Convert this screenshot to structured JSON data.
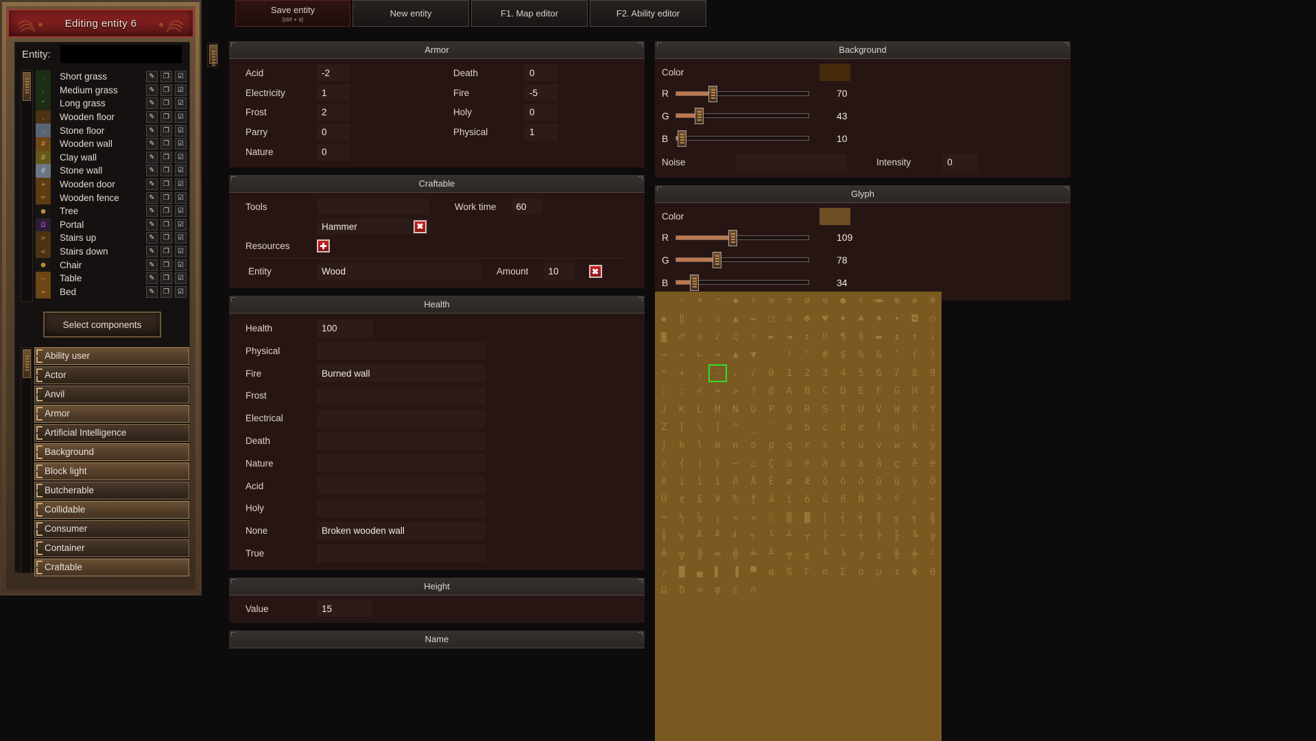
{
  "window": {
    "title": "Editing entity 6"
  },
  "left": {
    "entity_label": "Entity:",
    "entity_value": "",
    "select_components_label": "Select components",
    "entities": [
      {
        "name": "Short grass",
        "glyph": ".",
        "glyph_color": "#4e7a3a",
        "bg": "#1d2d16"
      },
      {
        "name": "Medium grass",
        "glyph": ",",
        "glyph_color": "#4e7a3a",
        "bg": "#1d2d16"
      },
      {
        "name": "Long grass",
        "glyph": "“",
        "glyph_color": "#4e7a3a",
        "bg": "#1d2d16"
      },
      {
        "name": "Wooden floor",
        "glyph": ".",
        "glyph_color": "#b07a38",
        "bg": "#4a3213"
      },
      {
        "name": "Stone floor",
        "glyph": ".",
        "glyph_color": "#9aa7b5",
        "bg": "#5a6472"
      },
      {
        "name": "Wooden wall",
        "glyph": "#",
        "glyph_color": "#c88a45",
        "bg": "#6d4616"
      },
      {
        "name": "Clay wall",
        "glyph": "#",
        "glyph_color": "#b2a13c",
        "bg": "#63591c"
      },
      {
        "name": "Stone wall",
        "glyph": "#",
        "glyph_color": "#b4bcc6",
        "bg": "#6b7684"
      },
      {
        "name": "Wooden door",
        "glyph": "+",
        "glyph_color": "#c88a45",
        "bg": "#5c3c13"
      },
      {
        "name": "Wooden fence",
        "glyph": "=",
        "glyph_color": "#c88a45",
        "bg": "#5c3c13"
      },
      {
        "name": "Tree",
        "glyph": "●",
        "glyph_color": "#c08b3c",
        "bg": "#181513"
      },
      {
        "name": "Portal",
        "glyph": "Ω",
        "glyph_color": "#d24fd2",
        "bg": "#2a1f36"
      },
      {
        "name": "Stairs up",
        "glyph": ">",
        "glyph_color": "#c88a45",
        "bg": "#4a3213"
      },
      {
        "name": "Stairs down",
        "glyph": "<",
        "glyph_color": "#c88a45",
        "bg": "#4a3213"
      },
      {
        "name": "Chair",
        "glyph": "●",
        "glyph_color": "#c08b3c",
        "bg": "#181513"
      },
      {
        "name": "Table",
        "glyph": "—",
        "glyph_color": "#c08b3c",
        "bg": "#6d4616"
      },
      {
        "name": "Bed",
        "glyph": "=",
        "glyph_color": "#d2894a",
        "bg": "#6d4616"
      }
    ],
    "row_buttons": [
      "picker-icon",
      "copy-icon",
      "edit-icon"
    ],
    "components": [
      {
        "label": "Ability user",
        "active": true
      },
      {
        "label": "Actor",
        "active": false
      },
      {
        "label": "Anvil",
        "active": false
      },
      {
        "label": "Armor",
        "active": true
      },
      {
        "label": "Artificial Intelligence",
        "active": false
      },
      {
        "label": "Background",
        "active": true
      },
      {
        "label": "Block light",
        "active": true
      },
      {
        "label": "Butcherable",
        "active": false
      },
      {
        "label": "Collidable",
        "active": true
      },
      {
        "label": "Consumer",
        "active": false
      },
      {
        "label": "Container",
        "active": false
      },
      {
        "label": "Craftable",
        "active": true
      }
    ]
  },
  "toolbar": {
    "save_label": "Save entity",
    "save_shortcut": "[ctrl + s]",
    "new_entity_label": "New entity",
    "map_editor_label": "F1. Map editor",
    "ability_editor_label": "F2. Ability editor"
  },
  "armor": {
    "title": "Armor",
    "fields": [
      {
        "label": "Acid",
        "value": "-2"
      },
      {
        "label": "Death",
        "value": "0"
      },
      {
        "label": "Electricity",
        "value": "1"
      },
      {
        "label": "Fire",
        "value": "-5"
      },
      {
        "label": "Frost",
        "value": "2"
      },
      {
        "label": "Holy",
        "value": "0"
      },
      {
        "label": "Parry",
        "value": "0"
      },
      {
        "label": "Physical",
        "value": "1"
      },
      {
        "label": "Nature",
        "value": "0"
      }
    ]
  },
  "craftable": {
    "title": "Craftable",
    "tools_label": "Tools",
    "tools_value": "",
    "work_time_label": "Work time",
    "work_time_value": "60",
    "tool_item": "Hammer",
    "tool_remove_icon": "remove-icon",
    "resources_label": "Resources",
    "resources_add_icon": "add-icon",
    "entity_label": "Entity",
    "entity_value": "Wood",
    "amount_label": "Amount",
    "amount_value": "10",
    "resource_remove_icon": "remove-icon"
  },
  "health": {
    "title": "Health",
    "fields": [
      {
        "label": "Health",
        "value": "100",
        "wide": false
      },
      {
        "label": "Physical",
        "value": "",
        "wide": true
      },
      {
        "label": "Fire",
        "value": "Burned wall",
        "wide": true
      },
      {
        "label": "Frost",
        "value": "",
        "wide": true
      },
      {
        "label": "Electrical",
        "value": "",
        "wide": true
      },
      {
        "label": "Death",
        "value": "",
        "wide": true
      },
      {
        "label": "Nature",
        "value": "",
        "wide": true
      },
      {
        "label": "Acid",
        "value": "",
        "wide": true
      },
      {
        "label": "Holy",
        "value": "",
        "wide": true
      },
      {
        "label": "None",
        "value": "Broken wooden wall",
        "wide": true
      },
      {
        "label": "True",
        "value": "",
        "wide": true
      }
    ]
  },
  "height": {
    "title": "Height",
    "value_label": "Value",
    "value": "15"
  },
  "name_section": {
    "title": "Name"
  },
  "background": {
    "title": "Background",
    "color_label": "Color",
    "color_hex": "#462b0a",
    "sliders": [
      {
        "name": "R",
        "value": 70
      },
      {
        "name": "G",
        "value": 43
      },
      {
        "name": "B",
        "value": 10
      }
    ],
    "noise_label": "Noise",
    "noise_value": "",
    "intensity_label": "Intensity",
    "intensity_value": "0"
  },
  "glyph": {
    "title": "Glyph",
    "color_label": "Color",
    "color_hex": "#6d4e22",
    "sliders": [
      {
        "name": "R",
        "value": 109
      },
      {
        "name": "G",
        "value": 78
      },
      {
        "name": "B",
        "value": 34
      }
    ],
    "selected_char": "#",
    "selected_index": 67,
    "grid_bg": "#7a5a20",
    "glyph_fg": "#9d7b3d",
    "selection_color": "#2ee02e",
    "chars": [
      " ",
      "·",
      "×",
      "⌒",
      "◆",
      "♯",
      "⚒",
      "⚗",
      "⚙",
      "⚒",
      "●",
      "↑",
      "◄►",
      "❆",
      "❁",
      "❄",
      "◆",
      "‖",
      "⚔",
      "⌂",
      "▲",
      "✒",
      "□",
      "☺",
      "☻",
      "♥",
      "♦",
      "♣",
      "♠",
      "•",
      "◘",
      "○",
      "◙",
      "♂",
      "♀",
      "♪",
      "♫",
      "☼",
      "►",
      "◄",
      "↕",
      "‼",
      "¶",
      "§",
      "▬",
      "↨",
      "↑",
      "↓",
      "→",
      "←",
      "∟",
      "↔",
      "▲",
      "▼",
      " ",
      "!",
      "\"",
      "#",
      "$",
      "%",
      "&",
      "'",
      "(",
      ")",
      "*",
      "+",
      ",",
      "-",
      ".",
      "/",
      "0",
      "1",
      "2",
      "3",
      "4",
      "5",
      "6",
      "7",
      "8",
      "9",
      ":",
      ";",
      "<",
      "=",
      ">",
      "?",
      "@",
      "A",
      "B",
      "C",
      "D",
      "E",
      "F",
      "G",
      "H",
      "I",
      "J",
      "K",
      "L",
      "M",
      "N",
      "O",
      "P",
      "Q",
      "R",
      "S",
      "T",
      "U",
      "V",
      "W",
      "X",
      "Y",
      "Z",
      "[",
      "\\",
      "]",
      "^",
      "_",
      "`",
      "a",
      "b",
      "c",
      "d",
      "e",
      "f",
      "g",
      "h",
      "i",
      "j",
      "k",
      "l",
      "m",
      "n",
      "o",
      "p",
      "q",
      "r",
      "s",
      "t",
      "u",
      "v",
      "w",
      "x",
      "y",
      "z",
      "{",
      "|",
      "}",
      "~",
      "⌂",
      "Ç",
      "ü",
      "é",
      "â",
      "ä",
      "à",
      "å",
      "ç",
      "ê",
      "ë",
      "è",
      "ï",
      "î",
      "ì",
      "Ä",
      "Å",
      "É",
      "æ",
      "Æ",
      "ô",
      "ö",
      "ò",
      "û",
      "ù",
      "ÿ",
      "Ö",
      "Ü",
      "¢",
      "£",
      "¥",
      "₧",
      "ƒ",
      "á",
      "í",
      "ó",
      "ú",
      "ñ",
      "Ñ",
      "ª",
      "º",
      "¿",
      "⌐",
      "¬",
      "½",
      "¼",
      "¡",
      "«",
      "»",
      "░",
      "▒",
      "▓",
      "│",
      "┤",
      "╡",
      "╢",
      "╖",
      "╕",
      "╣",
      "║",
      "╗",
      "╝",
      "╜",
      "╛",
      "┐",
      "└",
      "┴",
      "┬",
      "├",
      "─",
      "┼",
      "╞",
      "╟",
      "╚",
      "╔",
      "╩",
      "╦",
      "╠",
      "═",
      "╬",
      "╧",
      "╨",
      "╤",
      "╥",
      "╙",
      "╘",
      "╒",
      "╓",
      "╫",
      "╪",
      "┘",
      "┌",
      "█",
      "▄",
      "▌",
      "▐",
      "▀",
      "α",
      "ß",
      "Γ",
      "π",
      "Σ",
      "σ",
      "µ",
      "τ",
      "Φ",
      "Θ",
      "Ω",
      "δ",
      "∞",
      "φ",
      "ε",
      "∩"
    ]
  }
}
